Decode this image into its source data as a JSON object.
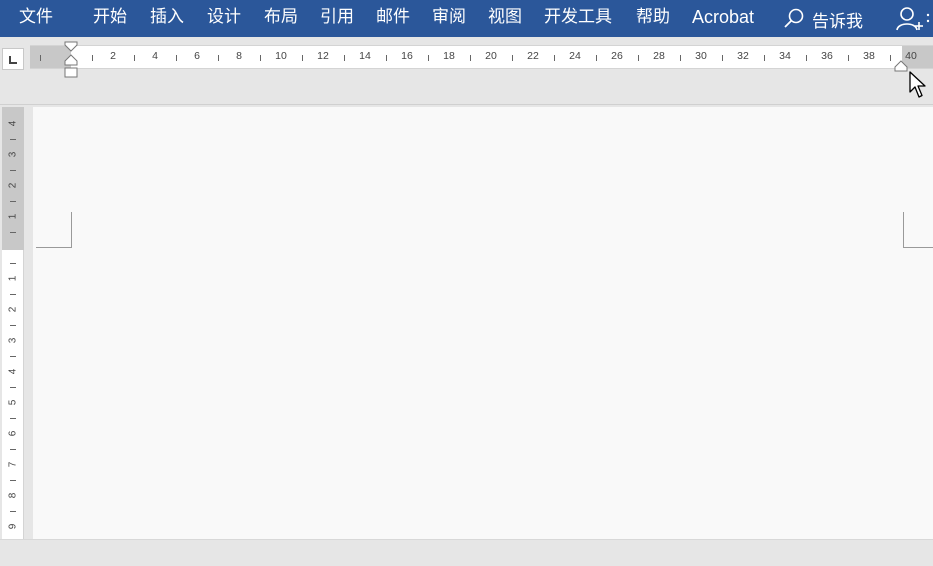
{
  "ribbon": {
    "tabs": [
      "文件",
      "开始",
      "插入",
      "设计",
      "布局",
      "引用",
      "邮件",
      "审阅",
      "视图",
      "开发工具",
      "帮助",
      "Acrobat"
    ],
    "search_label": "告诉我",
    "background": "#2b579a"
  },
  "horizontal_ruler": {
    "numbers": [
      "2",
      "4",
      "6",
      "8",
      "10",
      "12",
      "14",
      "16",
      "18",
      "20",
      "22",
      "24",
      "26",
      "28",
      "30",
      "32",
      "34",
      "36",
      "38",
      "40"
    ]
  },
  "vertical_ruler": {
    "top_numbers": [
      "4",
      "3",
      "2",
      "1"
    ],
    "body_numbers": [
      "1",
      "2",
      "3",
      "4",
      "5",
      "6",
      "7",
      "8",
      "9"
    ]
  },
  "icons": {
    "tab_selector": "left-tab-stop-icon",
    "search": "search-icon",
    "share": "share-user-icon",
    "cursor": "mouse-pointer-icon"
  }
}
